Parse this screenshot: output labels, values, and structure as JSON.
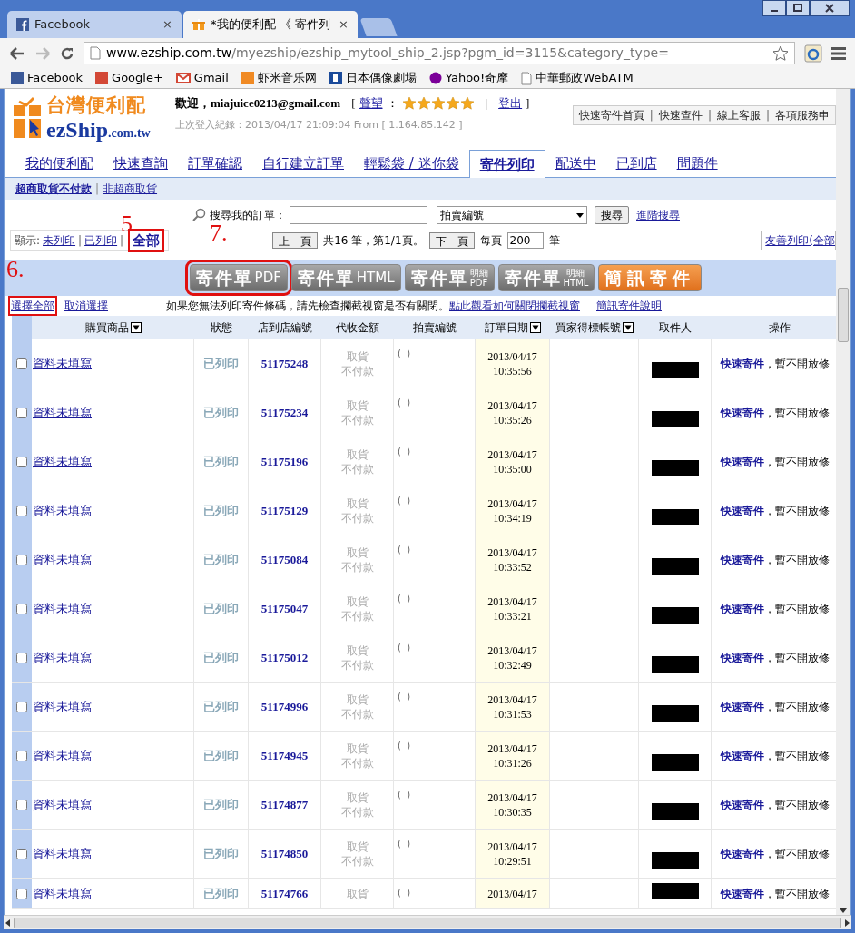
{
  "browser": {
    "tabs": [
      {
        "title": "Facebook",
        "selected": false,
        "close": "×"
      },
      {
        "title": "*我的便利配 《 寄件列",
        "selected": true,
        "close": "×"
      }
    ],
    "url": {
      "host": "www.ezship.com.tw",
      "path": "/myezship/ezship_mytool_ship_2.jsp?pgm_id=3115&category_type="
    },
    "bookmarks": [
      "Facebook",
      "Google+",
      "Gmail",
      "虾米音乐网",
      "日本偶像劇場",
      "Yahoo!奇摩",
      "中華郵政WebATM"
    ]
  },
  "header": {
    "logo_cn": "台灣便利配",
    "logo_en": "ezShip",
    "logo_domain": ".com.tw",
    "brackets": [
      "[",
      "]"
    ],
    "colon": "：",
    "separator": "|",
    "welcome": "歡迎，",
    "email": "miajuice0213@gmail.com",
    "reputation": "聲望",
    "stars": 5,
    "logout": "登出",
    "last_login": "上次登入紀錄：2013/04/17 21:09:04 From [ 1.164.85.142 ]",
    "top_links": [
      "快速寄件首頁",
      "快速查件",
      "線上客服",
      "各項服務申"
    ],
    "top_links_separator": "|"
  },
  "nav_tabs": [
    {
      "label": "我的便利配",
      "selected": false
    },
    {
      "label": "快速查詢",
      "selected": false
    },
    {
      "label": "訂單確認",
      "selected": false
    },
    {
      "label": "自行建立訂單",
      "selected": false
    },
    {
      "label": "輕鬆袋 / 迷你袋",
      "selected": false
    },
    {
      "label": "寄件列印",
      "selected": true
    },
    {
      "label": "配送中",
      "selected": false
    },
    {
      "label": "已到店",
      "selected": false
    },
    {
      "label": "問題件",
      "selected": false
    }
  ],
  "sub_tabs_separator": "|",
  "sub_tabs": [
    {
      "label": "超商取貨不付款",
      "selected": true
    },
    {
      "label": "非超商取貨",
      "selected": false
    }
  ],
  "search": {
    "label": "搜尋我的訂單：",
    "select": "拍賣編號",
    "button": "搜尋",
    "advanced": "進階搜尋"
  },
  "filter": {
    "label": "顯示:",
    "separator": "|",
    "options": [
      {
        "label": "未列印",
        "selected": false
      },
      {
        "label": "已列印",
        "selected": false
      },
      {
        "label": "全部",
        "selected": true
      }
    ]
  },
  "pager": {
    "prev": "上一頁",
    "info": "共16 筆，第1/1頁。",
    "next": "下一頁",
    "per_page_label": "每頁",
    "per_page": "200",
    "unit": "筆"
  },
  "friendly_print": "友善列印(全部",
  "print_buttons": [
    {
      "kind": "grey",
      "main": "寄件單",
      "sub": [
        "PDF"
      ]
    },
    {
      "kind": "grey",
      "main": "寄件單",
      "sub": [
        "HTML"
      ]
    },
    {
      "kind": "grey",
      "main": "寄件單",
      "sub": [
        "明細",
        "PDF"
      ]
    },
    {
      "kind": "grey",
      "main": "寄件單",
      "sub": [
        "明細",
        "HTML"
      ]
    },
    {
      "kind": "orange",
      "main": "簡訊寄件"
    }
  ],
  "select_all": "選擇全部",
  "deselect": "取消選擇",
  "notice": "如果您無法列印寄件條碼，請先檢查攔截視窗是否有關閉。",
  "notice_link": "點此觀看如何關閉攔截視窗",
  "sms_help": "簡訊寄件說明",
  "annotations": [
    "5.",
    "6.",
    "7."
  ],
  "table": {
    "columns": [
      {
        "label": "購買商品",
        "sortable": true
      },
      {
        "label": "狀態",
        "sortable": false
      },
      {
        "label": "店到店編號",
        "sortable": false
      },
      {
        "label": "代收金額",
        "sortable": false
      },
      {
        "label": "拍賣編號",
        "sortable": false
      },
      {
        "label": "訂單日期",
        "sortable": true
      },
      {
        "label": "買家得標帳號",
        "sortable": true
      },
      {
        "label": "取件人",
        "sortable": false
      },
      {
        "label": "操作",
        "sortable": false
      }
    ],
    "rows": [
      {
        "checked": false,
        "product": "資料未填寫",
        "status": "已列印",
        "code": "51175248",
        "amount": [
          "取貨",
          "不付款"
        ],
        "auction": "(  )",
        "date": [
          "2013/04/17",
          "10:35:56"
        ],
        "action": "快速寄件",
        "action_note": "，暫不開放修"
      },
      {
        "checked": false,
        "product": "資料未填寫",
        "status": "已列印",
        "code": "51175234",
        "amount": [
          "取貨",
          "不付款"
        ],
        "auction": "(  )",
        "date": [
          "2013/04/17",
          "10:35:26"
        ],
        "action": "快速寄件",
        "action_note": "，暫不開放修"
      },
      {
        "checked": false,
        "product": "資料未填寫",
        "status": "已列印",
        "code": "51175196",
        "amount": [
          "取貨",
          "不付款"
        ],
        "auction": "(  )",
        "date": [
          "2013/04/17",
          "10:35:00"
        ],
        "action": "快速寄件",
        "action_note": "，暫不開放修"
      },
      {
        "checked": false,
        "product": "資料未填寫",
        "status": "已列印",
        "code": "51175129",
        "amount": [
          "取貨",
          "不付款"
        ],
        "auction": "(  )",
        "date": [
          "2013/04/17",
          "10:34:19"
        ],
        "action": "快速寄件",
        "action_note": "，暫不開放修"
      },
      {
        "checked": false,
        "product": "資料未填寫",
        "status": "已列印",
        "code": "51175084",
        "amount": [
          "取貨",
          "不付款"
        ],
        "auction": "(  )",
        "date": [
          "2013/04/17",
          "10:33:52"
        ],
        "action": "快速寄件",
        "action_note": "，暫不開放修"
      },
      {
        "checked": false,
        "product": "資料未填寫",
        "status": "已列印",
        "code": "51175047",
        "amount": [
          "取貨",
          "不付款"
        ],
        "auction": "(  )",
        "date": [
          "2013/04/17",
          "10:33:21"
        ],
        "action": "快速寄件",
        "action_note": "，暫不開放修"
      },
      {
        "checked": false,
        "product": "資料未填寫",
        "status": "已列印",
        "code": "51175012",
        "amount": [
          "取貨",
          "不付款"
        ],
        "auction": "(  )",
        "date": [
          "2013/04/17",
          "10:32:49"
        ],
        "action": "快速寄件",
        "action_note": "，暫不開放修"
      },
      {
        "checked": false,
        "product": "資料未填寫",
        "status": "已列印",
        "code": "51174996",
        "amount": [
          "取貨",
          "不付款"
        ],
        "auction": "(  )",
        "date": [
          "2013/04/17",
          "10:31:53"
        ],
        "action": "快速寄件",
        "action_note": "，暫不開放修"
      },
      {
        "checked": false,
        "product": "資料未填寫",
        "status": "已列印",
        "code": "51174945",
        "amount": [
          "取貨",
          "不付款"
        ],
        "auction": "(  )",
        "date": [
          "2013/04/17",
          "10:31:26"
        ],
        "action": "快速寄件",
        "action_note": "，暫不開放修"
      },
      {
        "checked": false,
        "product": "資料未填寫",
        "status": "已列印",
        "code": "51174877",
        "amount": [
          "取貨",
          "不付款"
        ],
        "auction": "(  )",
        "date": [
          "2013/04/17",
          "10:30:35"
        ],
        "action": "快速寄件",
        "action_note": "，暫不開放修"
      },
      {
        "checked": false,
        "product": "資料未填寫",
        "status": "已列印",
        "code": "51174850",
        "amount": [
          "取貨",
          "不付款"
        ],
        "auction": "(  )",
        "date": [
          "2013/04/17",
          "10:29:51"
        ],
        "action": "快速寄件",
        "action_note": "，暫不開放修"
      },
      {
        "checked": false,
        "product": "資料未填寫",
        "status": "已列印",
        "code": "51174766",
        "amount": [
          "取貨"
        ],
        "auction": "(  )",
        "date": [
          "2013/04/17"
        ],
        "action": "快速寄件",
        "action_note": "，暫不開放修"
      }
    ]
  }
}
